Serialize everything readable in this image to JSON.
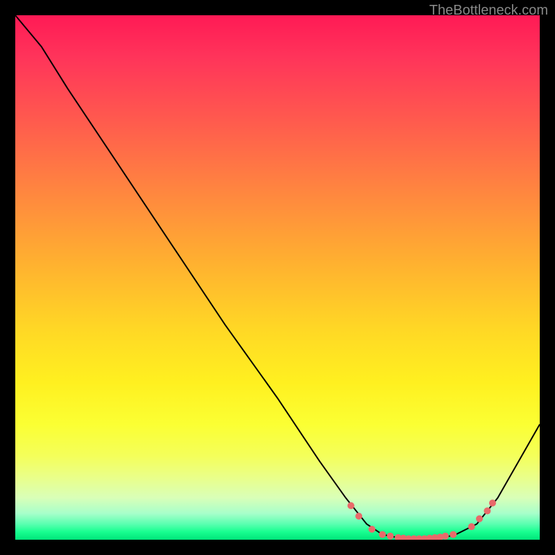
{
  "attribution": "TheBottleneck.com",
  "chart_data": {
    "type": "line",
    "title": "",
    "xlabel": "",
    "ylabel": "",
    "xlim": [
      0,
      100
    ],
    "ylim": [
      0,
      100
    ],
    "curve_points": [
      {
        "x": 0,
        "y": 100
      },
      {
        "x": 5,
        "y": 94
      },
      {
        "x": 10,
        "y": 86
      },
      {
        "x": 20,
        "y": 71
      },
      {
        "x": 30,
        "y": 56
      },
      {
        "x": 40,
        "y": 41
      },
      {
        "x": 50,
        "y": 27
      },
      {
        "x": 58,
        "y": 15
      },
      {
        "x": 63,
        "y": 8
      },
      {
        "x": 67,
        "y": 3
      },
      {
        "x": 70,
        "y": 1
      },
      {
        "x": 75,
        "y": 0
      },
      {
        "x": 80,
        "y": 0
      },
      {
        "x": 84,
        "y": 1
      },
      {
        "x": 88,
        "y": 3
      },
      {
        "x": 92,
        "y": 8
      },
      {
        "x": 96,
        "y": 15
      },
      {
        "x": 100,
        "y": 22
      }
    ],
    "marker_points": [
      {
        "x": 64,
        "y": 6.5
      },
      {
        "x": 65.5,
        "y": 4.5
      },
      {
        "x": 68,
        "y": 2
      },
      {
        "x": 70,
        "y": 1
      },
      {
        "x": 71.5,
        "y": 0.7
      },
      {
        "x": 73,
        "y": 0.4
      },
      {
        "x": 74,
        "y": 0.3
      },
      {
        "x": 75,
        "y": 0.2
      },
      {
        "x": 76,
        "y": 0.2
      },
      {
        "x": 77,
        "y": 0.2
      },
      {
        "x": 78,
        "y": 0.2
      },
      {
        "x": 79,
        "y": 0.3
      },
      {
        "x": 80,
        "y": 0.4
      },
      {
        "x": 81,
        "y": 0.5
      },
      {
        "x": 82,
        "y": 0.7
      },
      {
        "x": 83.5,
        "y": 1
      },
      {
        "x": 87,
        "y": 2.5
      },
      {
        "x": 88.5,
        "y": 4
      },
      {
        "x": 90,
        "y": 5.5
      },
      {
        "x": 91,
        "y": 7
      }
    ]
  }
}
